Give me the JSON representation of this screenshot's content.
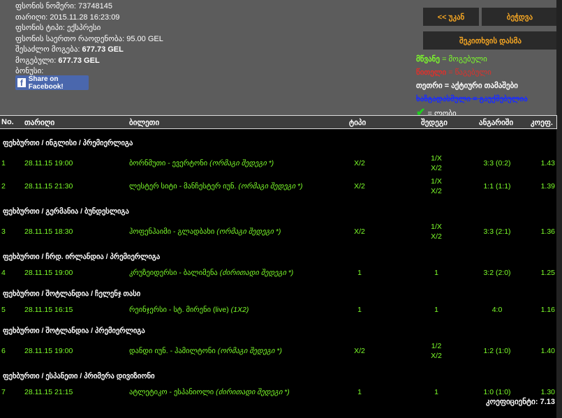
{
  "info": {
    "bet_number_label": "ფსონის ნომერი:",
    "bet_number": "73748145",
    "date_label": "თარიღი:",
    "date": "2015.11.28 16:23:09",
    "bet_type_label": "ფსონის ტიპი:",
    "bet_type": "ექსპრესი",
    "total_stake_label": "ფსონის საერთო რაოდენობა:",
    "total_stake": "95.00 GEL",
    "possible_win_label": "შესაძლო მოგება:",
    "possible_win": "677.73 GEL",
    "won_label": "მოგებული:",
    "won": "677.73 GEL",
    "bonus_label": "ბონუსი:"
  },
  "facebook_share": "Share on Facebook!",
  "buttons": {
    "back": "<< უკან",
    "print": "ბეჭდვა",
    "ask": "შეკითხვის დასმა"
  },
  "legend": {
    "green": "მწვანე",
    "green_desc": "= მოგებული",
    "red": "წითელი",
    "red_desc": "= წაგებული",
    "white": "თეთრი",
    "white_desc": "= აქტიური თამაშები",
    "strike": "ხაზგადასმული = გაუქმებულია",
    "check_desc": "= ლობი"
  },
  "colors": {
    "accent": "#f5a623",
    "win": "#7dff2a",
    "lose": "#e0302b",
    "cancelled": "#1a2cff"
  },
  "columns": {
    "no": "No.",
    "date": "თარიღი",
    "ticket": "ბილეთი",
    "type": "ტიპი",
    "result": "შედეგი",
    "score": "ანგარიში",
    "odds": "კოეფ."
  },
  "rows": [
    {
      "cat": "ფეხბურთი / ინგლისი / პრემიერლიგა"
    },
    {
      "no": "1",
      "date": "28.11.15 19:00",
      "match": "ბორნმუთი - ევერტონი",
      "market": "(ორმაგი შედეგი *)",
      "type": "X/2",
      "result": [
        "1/X",
        "X/2"
      ],
      "score": "3:3 (0:2)",
      "odds": "1.43"
    },
    {
      "no": "2",
      "date": "28.11.15 21:30",
      "match": "ლესტერ სიტი - მანჩესტერ იუნ.",
      "market": "(ორმაგი შედეგი *)",
      "type": "X/2",
      "result": [
        "1/X",
        "X/2"
      ],
      "score": "1:1 (1:1)",
      "odds": "1.39"
    },
    {
      "cat": "ფეხბურთი / გერმანია / ბუნდესლიგა"
    },
    {
      "no": "3",
      "date": "28.11.15 18:30",
      "match": "ჰოფენჰაიმი - გლადბახი",
      "market": "(ორმაგი შედეგი *)",
      "type": "X/2",
      "result": [
        "1/X",
        "X/2"
      ],
      "score": "3:3 (2:1)",
      "odds": "1.36"
    },
    {
      "cat": "ფეხბურთი / ჩრდ. ირლანდია / პრემიერლიგა"
    },
    {
      "no": "4",
      "date": "28.11.15 19:00",
      "match": "კრუზეიდერსი - ბალიმენა",
      "market": "(ძირითადი შედეგი *)",
      "type": "1",
      "result": [
        "1"
      ],
      "score": "3:2 (2:0)",
      "odds": "1.25"
    },
    {
      "cat": "ფეხბურთი / შოტლანდია / ჩელენჯ თასი"
    },
    {
      "no": "5",
      "date": "28.11.15 16:15",
      "match": "რეინჯერსი - სტ. მირენი (live)",
      "market": "(1X2)",
      "type": "1",
      "result": [
        "1"
      ],
      "score": "4:0",
      "odds": "1.16"
    },
    {
      "cat": "ფეხბურთი / შოტლანდია / პრემიერლიგა"
    },
    {
      "no": "6",
      "date": "28.11.15 19:00",
      "match": "დანდი იუნ. - ჰამილტონი",
      "market": "(ორმაგი შედეგი *)",
      "type": "X/2",
      "result": [
        "1/2",
        "X/2"
      ],
      "score": "1:2 (1:0)",
      "odds": "1.40"
    },
    {
      "cat": "ფეხბურთი / ესპანეთი / პრიმერა დივიზიონი"
    },
    {
      "no": "7",
      "date": "28.11.15 21:15",
      "match": "ატლეტიკო - ესპანიოლი",
      "market": "(ძირითადი შედეგი *)",
      "type": "1",
      "result": [
        "1"
      ],
      "score": "1:0 (1:0)",
      "odds": "1.30"
    }
  ],
  "total": "კოეფიციენტი: 7.13"
}
